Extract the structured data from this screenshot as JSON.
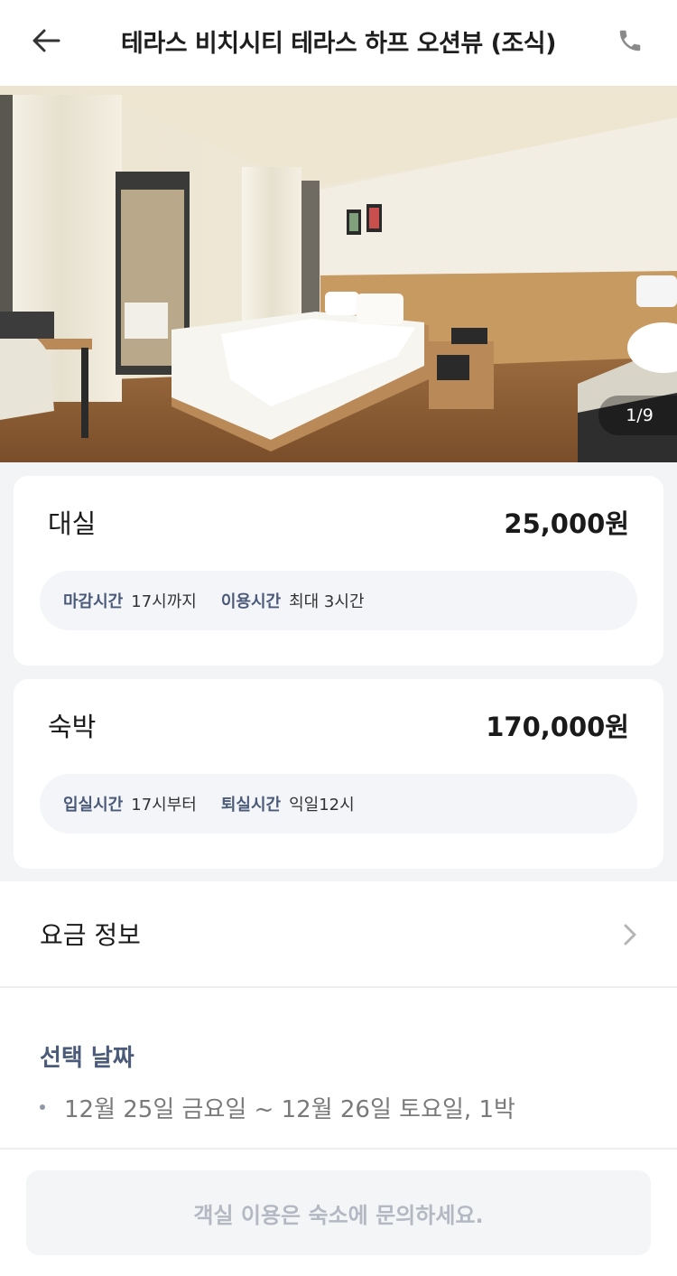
{
  "header": {
    "title": "테라스 비치시티 테라스 하프 오션뷰 (조식)",
    "back_icon": "back-arrow-icon",
    "phone_icon": "phone-icon"
  },
  "photo": {
    "counter": "1/9"
  },
  "rent": {
    "label": "대실",
    "price": "25,000원",
    "info": [
      {
        "key": "마감시간",
        "value": "17시까지"
      },
      {
        "key": "이용시간",
        "value": "최대 3시간"
      }
    ]
  },
  "stay": {
    "label": "숙박",
    "price": "170,000원",
    "info": [
      {
        "key": "입실시간",
        "value": "17시부터"
      },
      {
        "key": "퇴실시간",
        "value": "익일12시"
      }
    ]
  },
  "rate_info": {
    "label": "요금 정보",
    "chevron_icon": "chevron-right-icon"
  },
  "selected_date": {
    "title": "선택 날짜",
    "value": "12월 25일 금요일 ~ 12월 26일 토요일, 1박"
  },
  "bottom": {
    "button_label": "객실 이용은 숙소에 문의하세요."
  },
  "colors": {
    "accent": "#4a5a78",
    "band": "#f3f4f6",
    "disabled_text": "#b3b8c2"
  }
}
